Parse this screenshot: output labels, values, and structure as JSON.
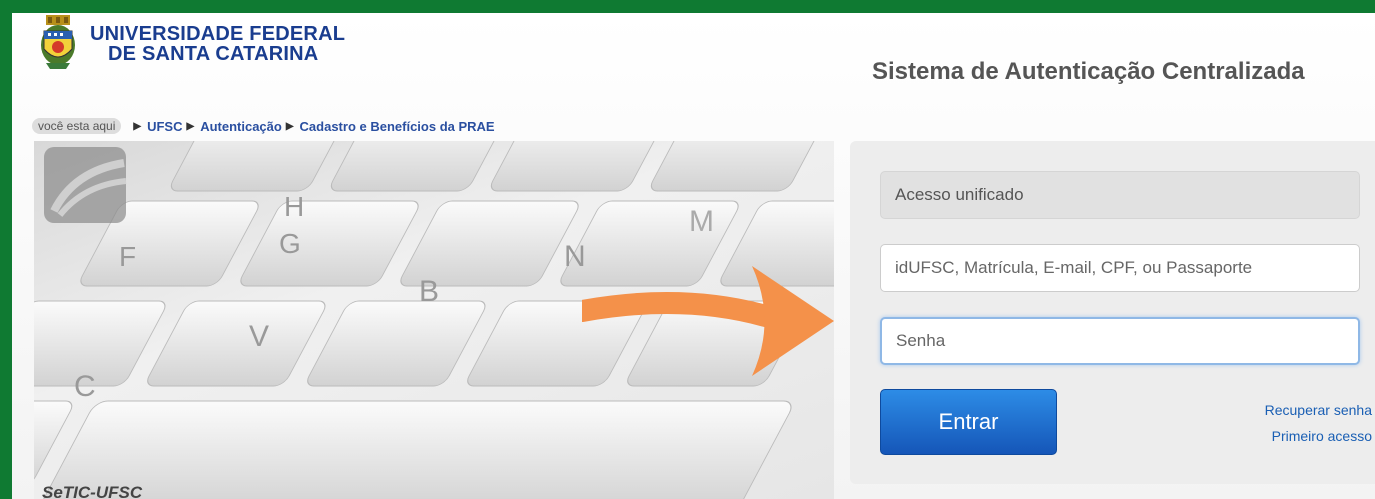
{
  "header": {
    "university_line1": "UNIVERSIDADE FEDERAL",
    "university_line2": "DE SANTA CATARINA",
    "system_title": "Sistema de Autenticação Centralizada"
  },
  "breadcrumb": {
    "here_label": "você esta aqui",
    "items": [
      "UFSC",
      "Autenticação",
      "Cadastro e Benefícios da PRAE"
    ]
  },
  "keyboard_image": {
    "keys": [
      "F",
      "G",
      "H",
      "V",
      "B",
      "N",
      "M",
      "C"
    ],
    "watermark": "SeTIC-UFSC"
  },
  "login": {
    "unified_label": "Acesso unificado",
    "username_placeholder": "idUFSC, Matrícula, E-mail, CPF, ou Passaporte",
    "password_placeholder": "Senha",
    "submit_label": "Entrar",
    "recover_link": "Recuperar senha",
    "first_access_link": "Primeiro acesso"
  },
  "colors": {
    "frame_green": "#0f7a32",
    "brand_blue": "#1a3d8f",
    "button_blue": "#1556b8",
    "arrow_orange": "#f4914a"
  }
}
